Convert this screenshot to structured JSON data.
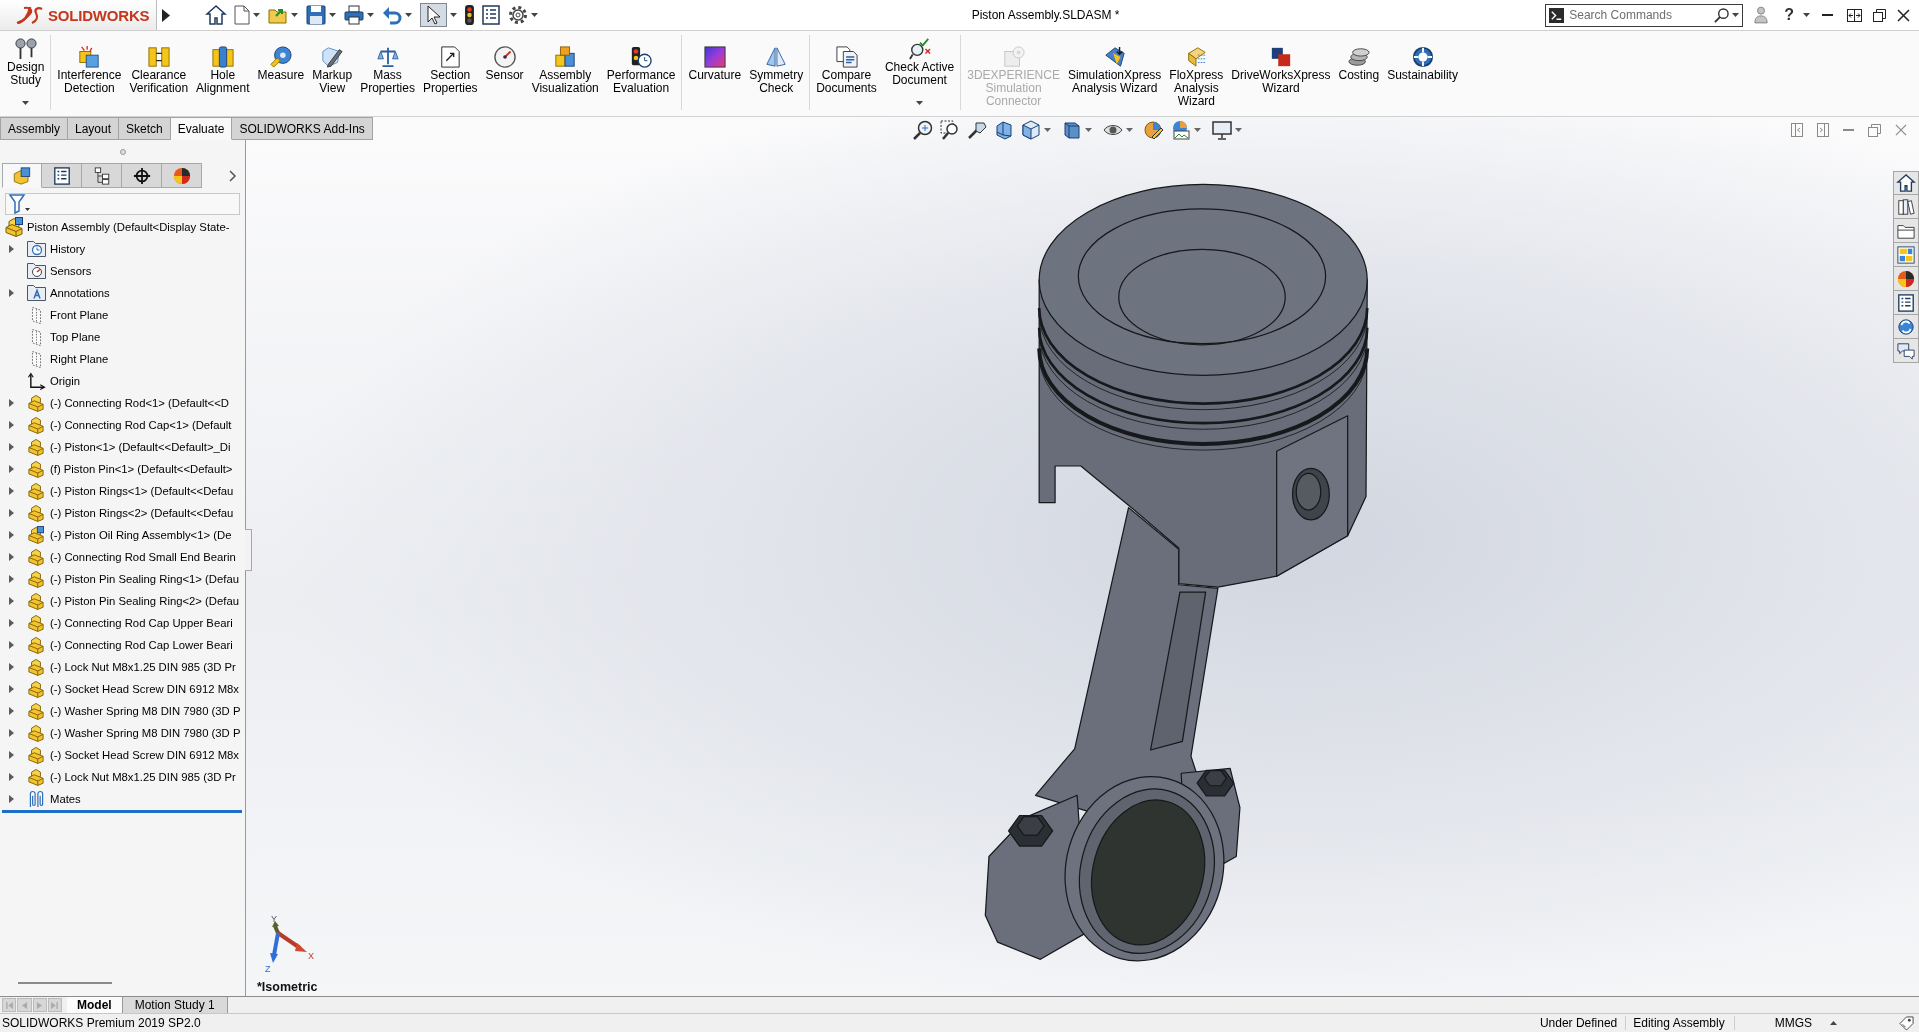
{
  "title_bar": {
    "app_name": "SOLIDWORKS",
    "quick_access": [
      {
        "pressed": false
      },
      {
        "pressed": false
      },
      {
        "pressed": false
      },
      {
        "pressed": false
      },
      {
        "pressed": false
      },
      {
        "pressed": false
      },
      {
        "pressed": true
      },
      {
        "pressed": false
      },
      {
        "pressed": false
      },
      {
        "pressed": false
      }
    ],
    "document_title": "Piston Assembly.SLDASM *",
    "search": {
      "placeholder": "Search Commands"
    },
    "help": "?"
  },
  "ribbon": {
    "groups": [
      {
        "commands": [
          {
            "label": "Design\nStudy",
            "dropdown": true,
            "disabled": false
          }
        ]
      },
      {
        "commands": [
          {
            "label": "Interference\nDetection",
            "dropdown": false,
            "disabled": false
          },
          {
            "label": "Clearance\nVerification",
            "dropdown": false,
            "disabled": false
          },
          {
            "label": "Hole\nAlignment",
            "dropdown": false,
            "disabled": false
          },
          {
            "label": "Measure",
            "dropdown": false,
            "disabled": false
          },
          {
            "label": "Markup\nView",
            "dropdown": false,
            "disabled": false
          },
          {
            "label": "Mass\nProperties",
            "dropdown": false,
            "disabled": false
          },
          {
            "label": "Section\nProperties",
            "dropdown": false,
            "disabled": false
          },
          {
            "label": "Sensor",
            "dropdown": false,
            "disabled": false
          },
          {
            "label": "Assembly\nVisualization",
            "dropdown": false,
            "disabled": false
          },
          {
            "label": "Performance\nEvaluation",
            "dropdown": false,
            "disabled": false
          }
        ]
      },
      {
        "commands": [
          {
            "label": "Curvature",
            "dropdown": false,
            "disabled": false
          },
          {
            "label": "Symmetry\nCheck",
            "dropdown": false,
            "disabled": false
          }
        ]
      },
      {
        "commands": [
          {
            "label": "Compare\nDocuments",
            "dropdown": false,
            "disabled": false
          },
          {
            "label": "Check Active\nDocument",
            "dropdown": true,
            "disabled": false
          }
        ]
      },
      {
        "commands": [
          {
            "label": "3DEXPERIENCE\nSimulation\nConnector",
            "dropdown": false,
            "disabled": true
          },
          {
            "label": "SimulationXpress\nAnalysis Wizard",
            "dropdown": false,
            "disabled": false
          },
          {
            "label": "FloXpress\nAnalysis\nWizard",
            "dropdown": false,
            "disabled": false
          },
          {
            "label": "DriveWorksXpress\nWizard",
            "dropdown": false,
            "disabled": false
          },
          {
            "label": "Costing",
            "dropdown": false,
            "disabled": false
          },
          {
            "label": "Sustainability",
            "dropdown": false,
            "disabled": false
          }
        ]
      }
    ]
  },
  "command_tabs": [
    {
      "label": "Assembly",
      "selected": false
    },
    {
      "label": "Layout",
      "selected": false
    },
    {
      "label": "Sketch",
      "selected": false
    },
    {
      "label": "Evaluate",
      "selected": true
    },
    {
      "label": "SOLIDWORKS Add-Ins",
      "selected": false
    }
  ],
  "feature_manager": {
    "tabs": [
      {
        "selected": true
      },
      {
        "selected": false
      },
      {
        "selected": false
      },
      {
        "selected": false
      },
      {
        "selected": false
      }
    ],
    "root": {
      "label": "Piston Assembly (Default<Display State-",
      "kind": "assembly"
    },
    "items": [
      {
        "label": "History",
        "kind": "history",
        "expandable": true
      },
      {
        "label": "Sensors",
        "kind": "sensors",
        "expandable": false
      },
      {
        "label": "Annotations",
        "kind": "annotations",
        "expandable": true
      },
      {
        "label": "Front Plane",
        "kind": "plane",
        "expandable": false
      },
      {
        "label": "Top Plane",
        "kind": "plane",
        "expandable": false
      },
      {
        "label": "Right Plane",
        "kind": "plane",
        "expandable": false
      },
      {
        "label": "Origin",
        "kind": "origin",
        "expandable": false
      },
      {
        "label": "(-) Connecting Rod<1> (Default<<D",
        "kind": "part",
        "expandable": true
      },
      {
        "label": "(-) Connecting Rod Cap<1> (Default",
        "kind": "part",
        "expandable": true
      },
      {
        "label": "(-) Piston<1> (Default<<Default>_Di",
        "kind": "part",
        "expandable": true
      },
      {
        "label": "(f) Piston Pin<1> (Default<<Default>",
        "kind": "part",
        "expandable": true
      },
      {
        "label": "(-) Piston Rings<1> (Default<<Defau",
        "kind": "part",
        "expandable": true
      },
      {
        "label": "(-) Piston Rings<2> (Default<<Defau",
        "kind": "part",
        "expandable": true
      },
      {
        "label": "(-) Piston Oil Ring Assembly<1> (De",
        "kind": "subassembly",
        "expandable": true
      },
      {
        "label": "(-) Connecting Rod Small End Bearin",
        "kind": "part",
        "expandable": true
      },
      {
        "label": "(-) Piston Pin Sealing Ring<1> (Defau",
        "kind": "part",
        "expandable": true
      },
      {
        "label": "(-) Piston Pin Sealing Ring<2> (Defau",
        "kind": "part",
        "expandable": true
      },
      {
        "label": "(-) Connecting Rod Cap Upper Beari",
        "kind": "part",
        "expandable": true
      },
      {
        "label": "(-) Connecting Rod Cap Lower Beari",
        "kind": "part",
        "expandable": true
      },
      {
        "label": "(-) Lock Nut M8x1.25 DIN 985 (3D Pr",
        "kind": "part",
        "expandable": true
      },
      {
        "label": "(-) Socket Head Screw DIN 6912 M8x",
        "kind": "part",
        "expandable": true
      },
      {
        "label": "(-) Washer Spring M8 DIN 7980 (3D P",
        "kind": "part",
        "expandable": true
      },
      {
        "label": "(-) Washer Spring M8 DIN 7980 (3D P",
        "kind": "part",
        "expandable": true
      },
      {
        "label": "(-) Socket Head Screw DIN 6912 M8x",
        "kind": "part",
        "expandable": true
      },
      {
        "label": "(-) Lock Nut M8x1.25 DIN 985 (3D Pr",
        "kind": "part",
        "expandable": true
      },
      {
        "label": "Mates",
        "kind": "mates",
        "expandable": true
      }
    ]
  },
  "graphics_area": {
    "view_label": "*Isometric",
    "triad": {
      "x": "X",
      "y": "Y",
      "z": "Z"
    }
  },
  "bottom_bar": {
    "nav_disabled": true,
    "tabs": [
      {
        "label": "Model",
        "selected": true
      },
      {
        "label": "Motion Study 1",
        "selected": false
      }
    ]
  },
  "status_bar": {
    "product": "SOLIDWORKS Premium 2019 SP2.0",
    "definition": "Under Defined",
    "mode": "Editing Assembly",
    "units": "MMGS"
  }
}
